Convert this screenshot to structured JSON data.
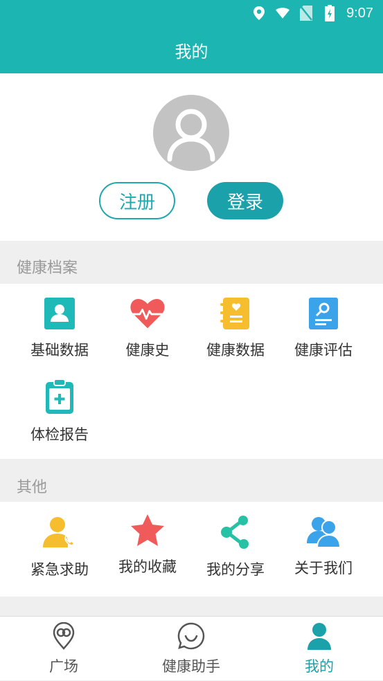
{
  "status_bar": {
    "time": "9:07",
    "icons": [
      "location-icon",
      "wifi-icon",
      "no-sim-icon",
      "battery-icon"
    ]
  },
  "header": {
    "title": "我的"
  },
  "profile": {
    "register_label": "注册",
    "login_label": "登录",
    "avatar": "default-user-icon"
  },
  "sections": {
    "health_records": {
      "title": "健康档案",
      "items": [
        {
          "label": "基础数据",
          "icon": "profile-card-icon",
          "color": "#1fbab8"
        },
        {
          "label": "健康史",
          "icon": "heartbeat-icon",
          "color": "#f05a5a"
        },
        {
          "label": "健康数据",
          "icon": "notebook-heart-icon",
          "color": "#f6be2e"
        },
        {
          "label": "健康评估",
          "icon": "assessment-doc-icon",
          "color": "#3aa3ea"
        },
        {
          "label": "体检报告",
          "icon": "clipboard-plus-icon",
          "color": "#1fbab8"
        }
      ]
    },
    "others": {
      "title": "其他",
      "items": [
        {
          "label": "紧急求助",
          "icon": "emergency-call-icon",
          "color": "#f6be2e"
        },
        {
          "label": "我的收藏",
          "icon": "star-icon",
          "color": "#f05a5a"
        },
        {
          "label": "我的分享",
          "icon": "share-icon",
          "color": "#27c1a6"
        },
        {
          "label": "关于我们",
          "icon": "people-icon",
          "color": "#3aa3ea"
        }
      ]
    }
  },
  "bottom_nav": {
    "tabs": [
      {
        "label": "广场",
        "icon": "plaza-pin-icon",
        "active": false
      },
      {
        "label": "健康助手",
        "icon": "chat-bubble-icon",
        "active": false
      },
      {
        "label": "我的",
        "icon": "user-icon",
        "active": true
      }
    ],
    "active_color": "#1aa1aa"
  }
}
